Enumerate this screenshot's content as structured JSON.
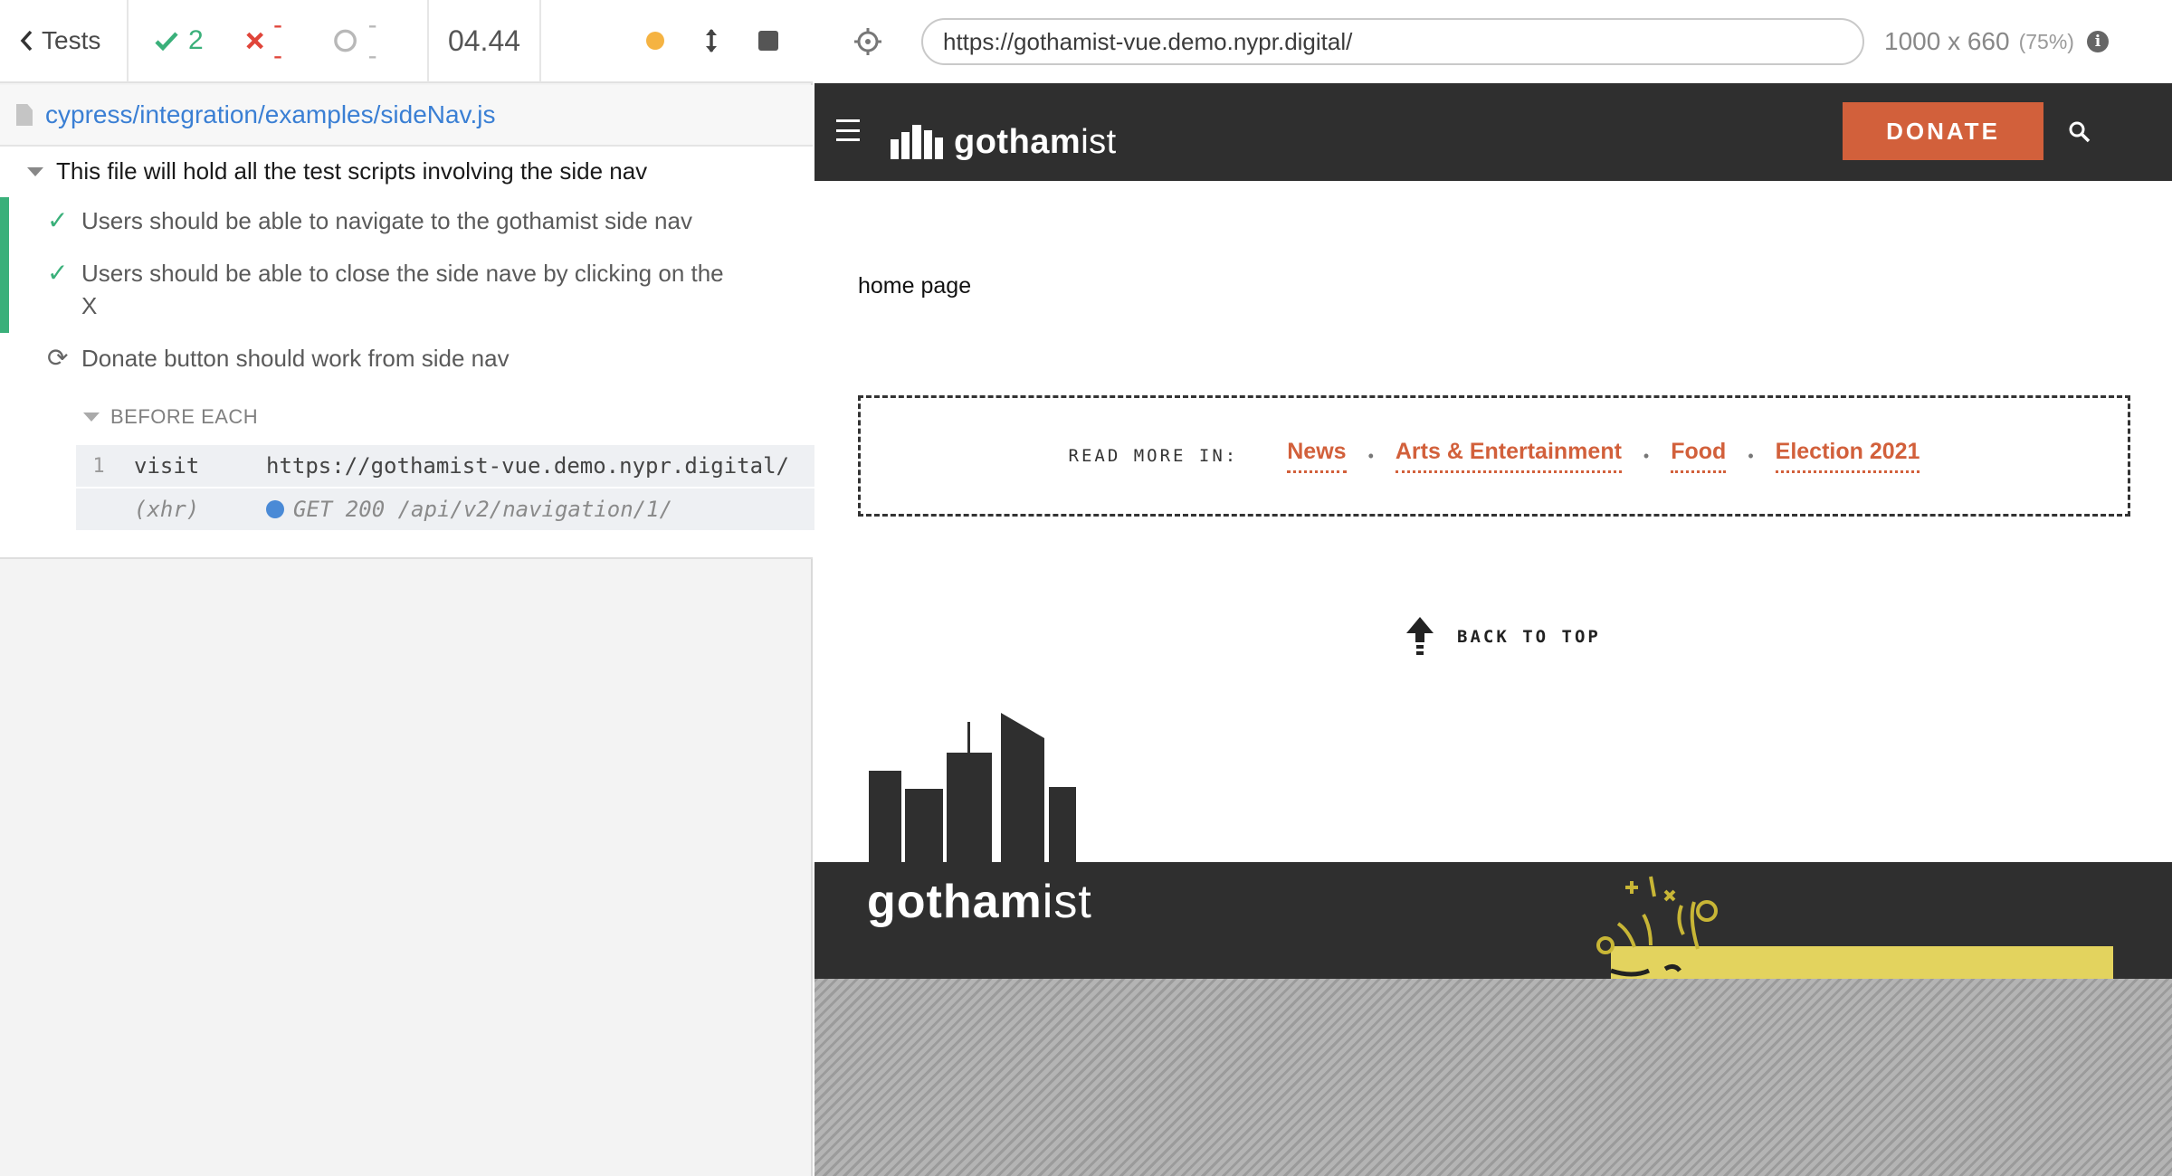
{
  "reporter": {
    "tests_label": "Tests",
    "stats": {
      "passed": "2",
      "failed": "--",
      "pending": "--"
    },
    "duration": "04.44",
    "spec_path": "cypress/integration/examples/sideNav.js",
    "suite": {
      "title": "This file will hold all the test scripts involving the side nav",
      "tests": [
        {
          "label": "Users should be able to navigate to the gothamist side nav",
          "state": "passed"
        },
        {
          "label": "Users should be able to close the side nave by clicking on the X",
          "state": "passed"
        },
        {
          "label": "Donate button should work from side nav",
          "state": "running"
        }
      ],
      "hook": {
        "title": "BEFORE EACH",
        "commands": [
          {
            "num": "1",
            "name": "visit",
            "message": "https://gothamist-vue.demo.nypr.digital/"
          },
          {
            "num": "",
            "name": "(xhr)",
            "message": "GET 200 /api/v2/navigation/1/"
          }
        ]
      }
    }
  },
  "aut": {
    "url": "https://gothamist-vue.demo.nypr.digital/",
    "viewport_size": "1000 x 660",
    "viewport_scale": "(75%)",
    "site": {
      "logo_bold": "gotham",
      "logo_light": "ist",
      "donate_label": "DONATE",
      "home_text": "home page",
      "read_more_label": "READ MORE IN:",
      "read_more_links": [
        "News",
        "Arts & Entertainment",
        "Food",
        "Election 2021"
      ],
      "back_to_top": "BACK TO TOP",
      "footer_logo_bold": "gotham",
      "footer_logo_light": "ist",
      "accent_color": "#d2603b",
      "header_color": "#2f2f2f"
    }
  },
  "icons": [
    "chevron-left-icon",
    "check-icon",
    "x-icon",
    "pending-circle-icon",
    "status-dot-icon",
    "resize-icon",
    "stop-icon",
    "file-icon",
    "crosshair-icon",
    "info-icon",
    "hamburger-icon",
    "search-icon",
    "arrow-up-icon",
    "refresh-icon"
  ]
}
